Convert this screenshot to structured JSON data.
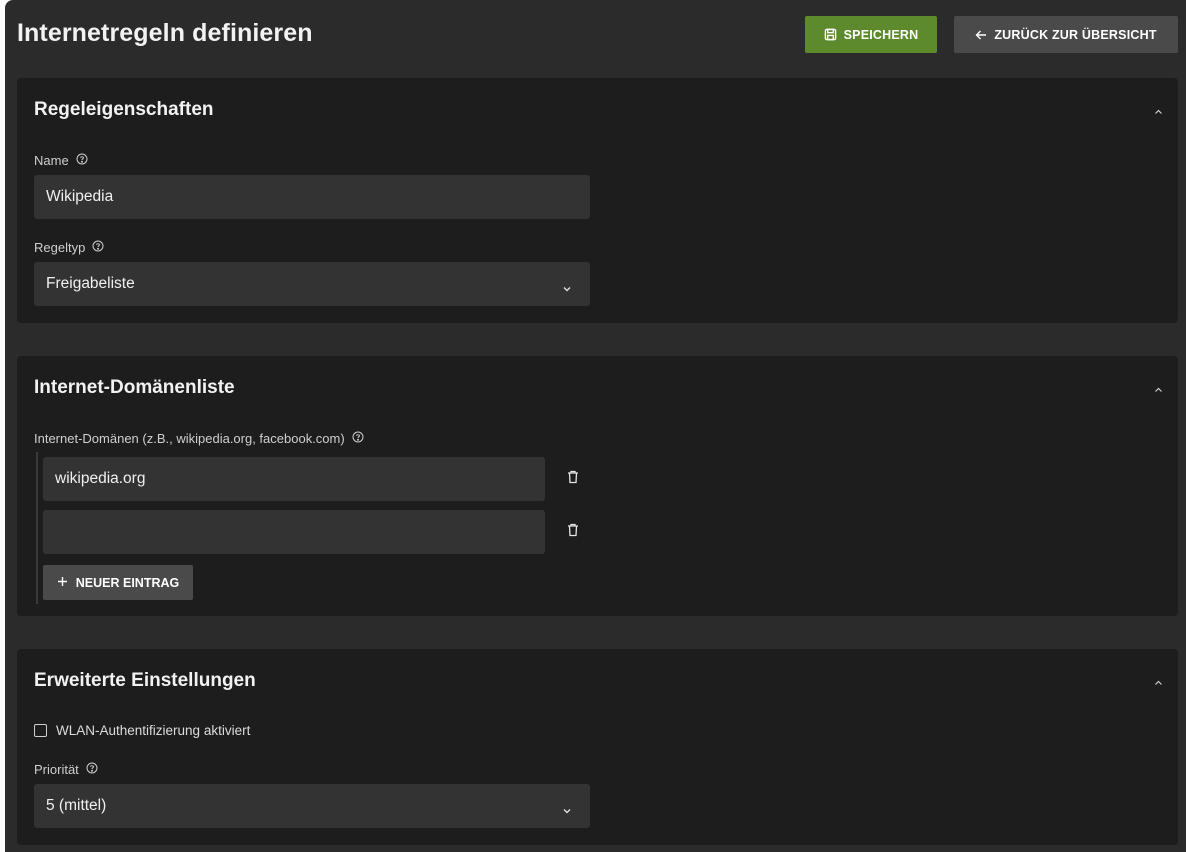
{
  "header": {
    "title": "Internetregeln definieren",
    "save_label": "SPEICHERN",
    "back_label": "ZURÜCK ZUR ÜBERSICHT"
  },
  "rule_properties": {
    "title": "Regeleigenschaften",
    "name_label": "Name",
    "name_value": "Wikipedia",
    "type_label": "Regeltyp",
    "type_value": "Freigabeliste"
  },
  "domain_list": {
    "title": "Internet-Domänenliste",
    "field_label": "Internet-Domänen (z.B., wikipedia.org, facebook.com)",
    "entries": [
      "wikipedia.org",
      ""
    ],
    "add_label": "NEUER EINTRAG"
  },
  "advanced": {
    "title": "Erweiterte Einstellungen",
    "wlan_auth_label": "WLAN-Authentifizierung aktiviert",
    "wlan_auth_checked": false,
    "priority_label": "Priorität",
    "priority_value": "5 (mittel)"
  },
  "colors": {
    "background": "#2b2b2b",
    "card": "#1d1d1d",
    "input": "#333333",
    "save_button": "#5c8a2c",
    "secondary_button": "#4a4a4a"
  },
  "icons": {
    "save": "floppy-disk-icon",
    "back": "arrow-left-icon",
    "help": "question-circle-icon",
    "collapse": "chevron-up-icon",
    "select": "chevron-down-icon",
    "delete": "trash-icon",
    "add": "plus-icon"
  }
}
